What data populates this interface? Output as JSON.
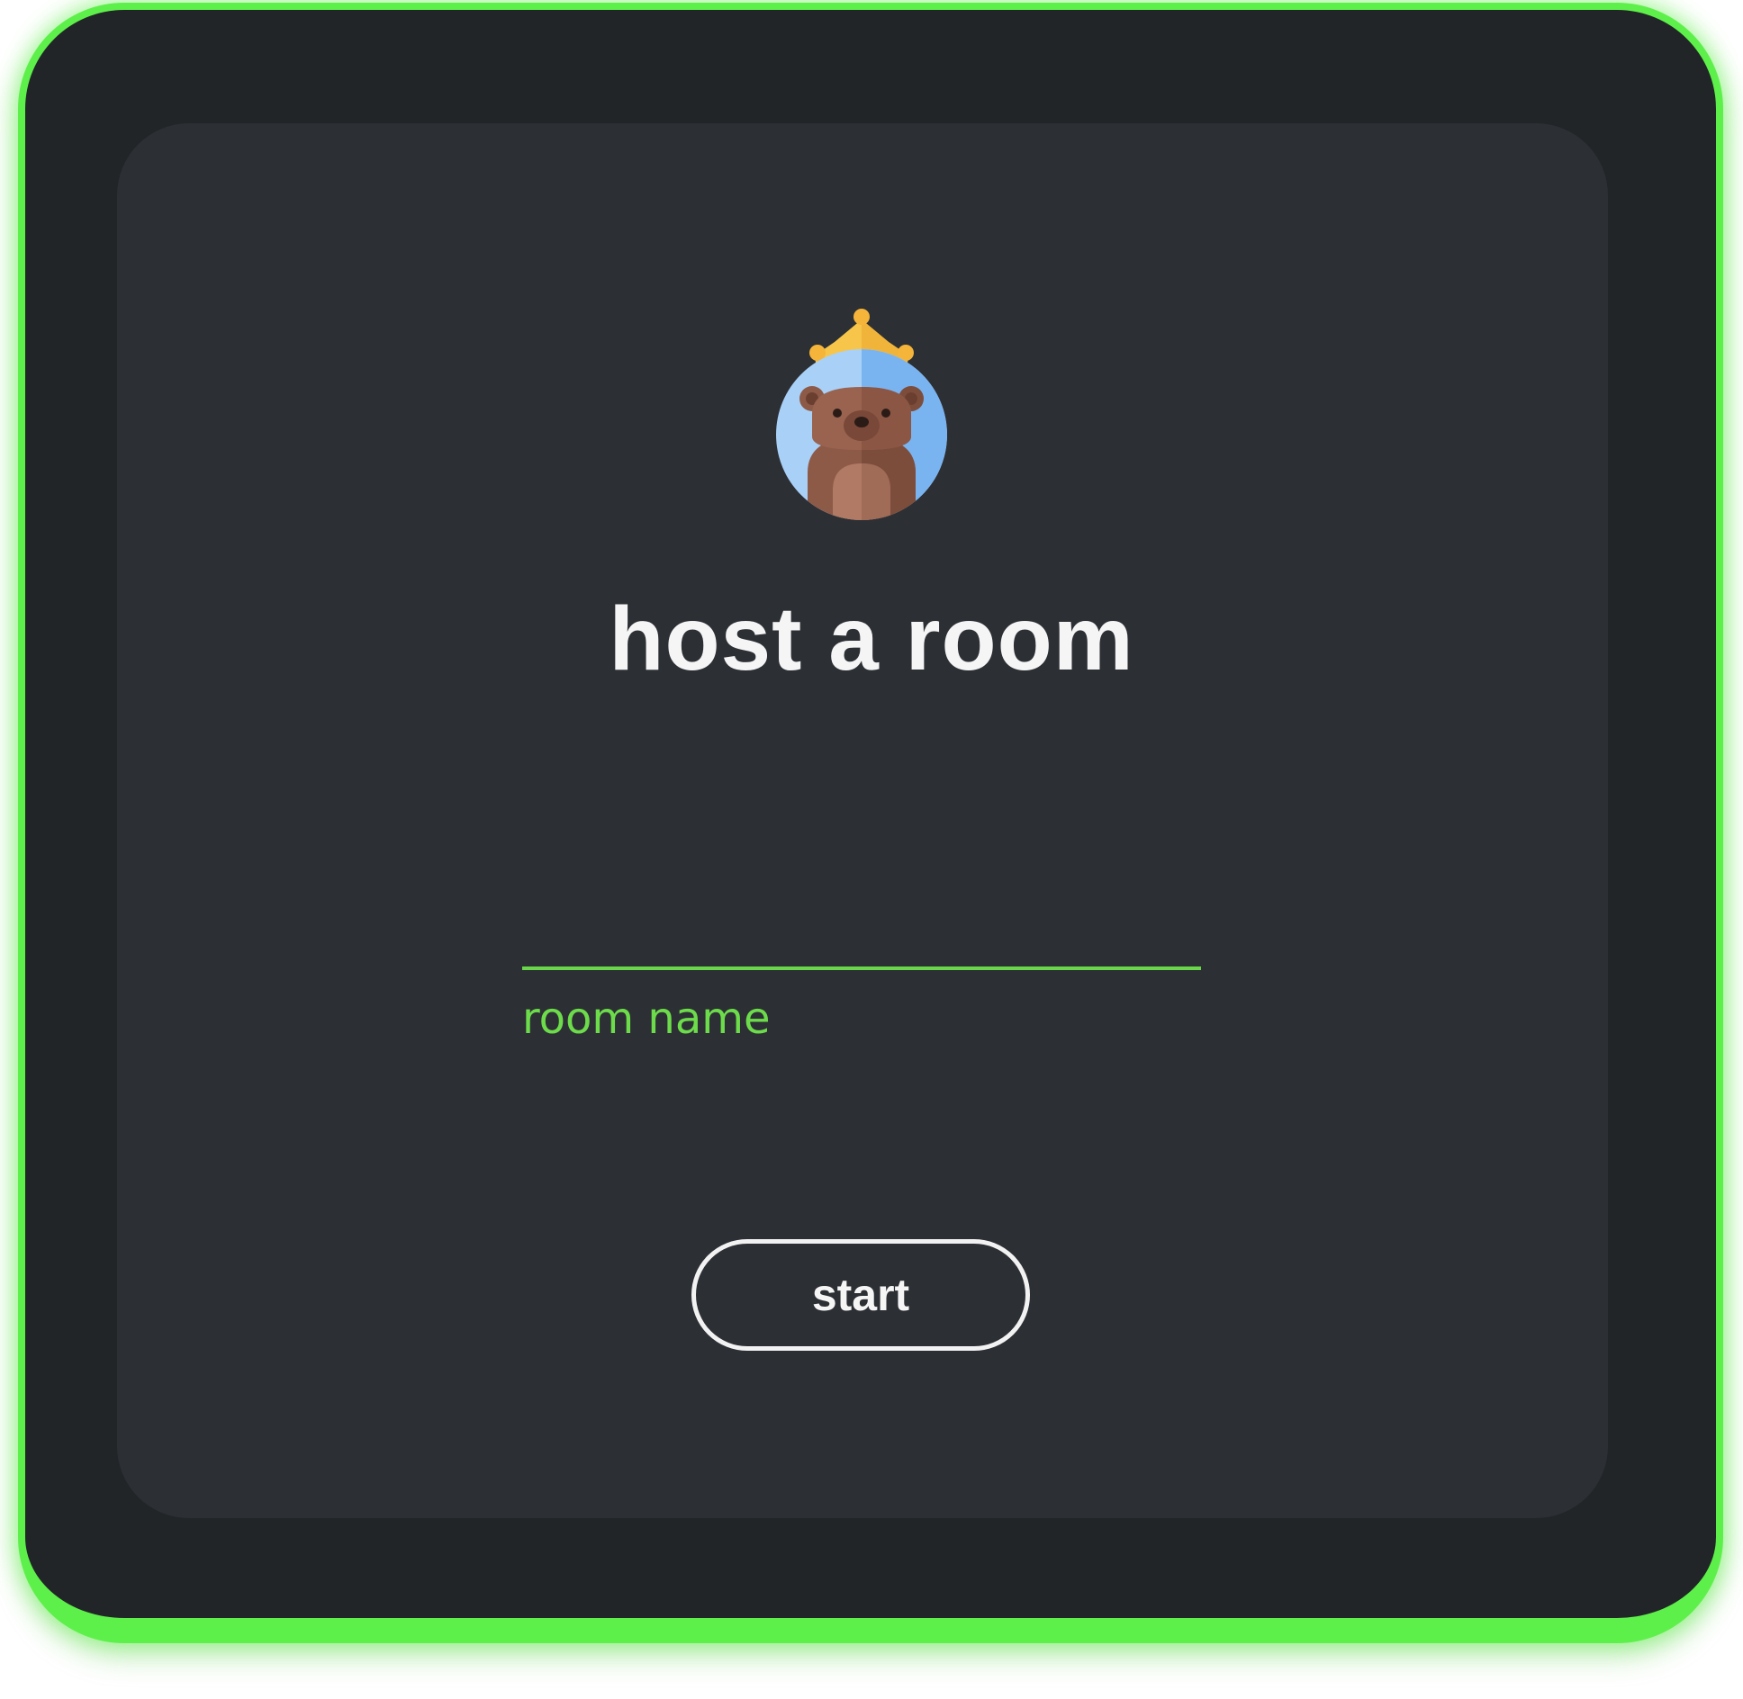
{
  "colors": {
    "frame_border": "#5ef04a",
    "frame_bg": "#222528",
    "panel_bg": "#2c2f34",
    "accent": "#6ddc4b",
    "text": "#f5f5f5"
  },
  "avatar": {
    "icon": "bear-with-crown-icon"
  },
  "title": "host a room",
  "room_field": {
    "value": "",
    "label": "room name"
  },
  "start_button": {
    "label": "start"
  }
}
